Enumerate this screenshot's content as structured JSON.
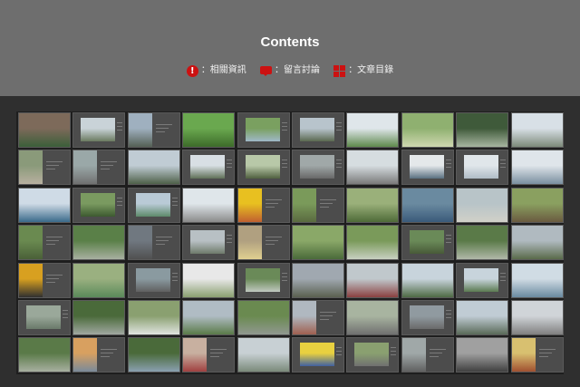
{
  "header": {
    "title": "Contents",
    "bg": "#6e6e6e"
  },
  "legend": {
    "accent": "#cc1111",
    "items": [
      {
        "icon": "info-icon",
        "label": "：相關資訊"
      },
      {
        "icon": "comment-icon",
        "label": "：留言討論"
      },
      {
        "icon": "grid-icon",
        "label": "：文章目錄"
      }
    ]
  },
  "gallery": {
    "rows": 7,
    "cols": 10,
    "thumbnails": [
      {
        "kind": "full",
        "colors": [
          "#7d6a5a",
          "#3b5f3a"
        ]
      },
      {
        "kind": "partial",
        "colors": [
          "#c9d3d8",
          "#6a7a60"
        ]
      },
      {
        "kind": "portrait",
        "colors": [
          "#9fb0bf",
          "#556055"
        ]
      },
      {
        "kind": "full",
        "colors": [
          "#6aa84f",
          "#3d6b2a"
        ]
      },
      {
        "kind": "partial",
        "colors": [
          "#7aa060",
          "#9fb8c8"
        ]
      },
      {
        "kind": "partial",
        "colors": [
          "#b8c4cc",
          "#5a6850"
        ]
      },
      {
        "kind": "full",
        "colors": [
          "#dfe6ea",
          "#5e8a4c"
        ]
      },
      {
        "kind": "full",
        "colors": [
          "#8fb070",
          "#cfd8b0"
        ]
      },
      {
        "kind": "full",
        "colors": [
          "#3f5a3a",
          "#a7b5a0"
        ]
      },
      {
        "kind": "full",
        "colors": [
          "#d8e0e6",
          "#7d8a7a"
        ]
      },
      {
        "kind": "portrait",
        "colors": [
          "#8a9a7a",
          "#b8b0a0"
        ]
      },
      {
        "kind": "portrait",
        "colors": [
          "#9aa8a8",
          "#707070"
        ]
      },
      {
        "kind": "full",
        "colors": [
          "#c0ccd4",
          "#4e6048"
        ]
      },
      {
        "kind": "partial",
        "colors": [
          "#d8dfe4",
          "#607058"
        ]
      },
      {
        "kind": "partial",
        "colors": [
          "#b8c8a8",
          "#506040"
        ]
      },
      {
        "kind": "partial",
        "colors": [
          "#a0a8a8",
          "#686868"
        ]
      },
      {
        "kind": "full",
        "colors": [
          "#d6dde0",
          "#7a7a7a"
        ]
      },
      {
        "kind": "partial",
        "colors": [
          "#e4e8ea",
          "#5a7080"
        ]
      },
      {
        "kind": "partial",
        "colors": [
          "#e0e6ea",
          "#b0bcc6"
        ]
      },
      {
        "kind": "full",
        "colors": [
          "#dfe5ea",
          "#7a8f9f"
        ]
      },
      {
        "kind": "full",
        "colors": [
          "#cfdbe6",
          "#3a6a8a"
        ]
      },
      {
        "kind": "partial",
        "colors": [
          "#7a9a60",
          "#3d5a30"
        ]
      },
      {
        "kind": "partial",
        "colors": [
          "#b9cad6",
          "#5d8a6a"
        ]
      },
      {
        "kind": "full",
        "colors": [
          "#dfe6ea",
          "#8a8a8a"
        ]
      },
      {
        "kind": "portrait",
        "colors": [
          "#e8c020",
          "#c06030"
        ]
      },
      {
        "kind": "portrait",
        "colors": [
          "#7a9a5a",
          "#5a6a40"
        ]
      },
      {
        "kind": "full",
        "colors": [
          "#9ab07a",
          "#4e6a38"
        ]
      },
      {
        "kind": "full",
        "colors": [
          "#6a8aa0",
          "#3a5a7a"
        ]
      },
      {
        "kind": "full",
        "colors": [
          "#b8c4c8",
          "#d0d0c8"
        ]
      },
      {
        "kind": "full",
        "colors": [
          "#8aa060",
          "#6a5a40"
        ]
      },
      {
        "kind": "portrait",
        "colors": [
          "#6a8a50",
          "#4a6038"
        ]
      },
      {
        "kind": "full",
        "colors": [
          "#5a8048",
          "#a8b0a0"
        ]
      },
      {
        "kind": "portrait",
        "colors": [
          "#707880",
          "#505050"
        ]
      },
      {
        "kind": "partial",
        "colors": [
          "#b8c0c4",
          "#6e7a6a"
        ]
      },
      {
        "kind": "portrait",
        "colors": [
          "#b0a080",
          "#e0d090"
        ]
      },
      {
        "kind": "full",
        "colors": [
          "#8aa868",
          "#4a6a3a"
        ]
      },
      {
        "kind": "full",
        "colors": [
          "#7a9a5a",
          "#c8d0c0"
        ]
      },
      {
        "kind": "partial",
        "colors": [
          "#6a8a58",
          "#485a38"
        ]
      },
      {
        "kind": "full",
        "colors": [
          "#5a7a48",
          "#b0b8a8"
        ]
      },
      {
        "kind": "full",
        "colors": [
          "#b0bac0",
          "#5a6a4a"
        ]
      },
      {
        "kind": "portrait",
        "colors": [
          "#d8a020",
          "#303030"
        ]
      },
      {
        "kind": "full",
        "colors": [
          "#9ab080",
          "#5a8a5a"
        ]
      },
      {
        "kind": "partial",
        "colors": [
          "#8a9aa0",
          "#606060"
        ]
      },
      {
        "kind": "full",
        "colors": [
          "#e8e8e8",
          "#8aa070"
        ]
      },
      {
        "kind": "partial",
        "colors": [
          "#6a8a58",
          "#c0c8c0"
        ]
      },
      {
        "kind": "full",
        "colors": [
          "#a0a8b0",
          "#5a6050"
        ]
      },
      {
        "kind": "full",
        "colors": [
          "#c0c8cc",
          "#8a4040"
        ]
      },
      {
        "kind": "full",
        "colors": [
          "#c8d4dc",
          "#4e6a44"
        ]
      },
      {
        "kind": "partial",
        "colors": [
          "#c8d4dc",
          "#5a7a50"
        ]
      },
      {
        "kind": "full",
        "colors": [
          "#d0dce4",
          "#6a8aa0"
        ]
      },
      {
        "kind": "partial",
        "colors": [
          "#9aa89a",
          "#6a7a6a"
        ]
      },
      {
        "kind": "full",
        "colors": [
          "#4a6a3a",
          "#a0a8a0"
        ]
      },
      {
        "kind": "full",
        "colors": [
          "#8aa070",
          "#e0e4e0"
        ]
      },
      {
        "kind": "full",
        "colors": [
          "#b0bcc4",
          "#5a7a48"
        ]
      },
      {
        "kind": "full",
        "colors": [
          "#6a8a50",
          "#909890"
        ]
      },
      {
        "kind": "portrait",
        "colors": [
          "#b0b8c0",
          "#a06050"
        ]
      },
      {
        "kind": "full",
        "colors": [
          "#a8b4a0",
          "#707070"
        ]
      },
      {
        "kind": "partial",
        "colors": [
          "#909aa0",
          "#6a6a6a"
        ]
      },
      {
        "kind": "full",
        "colors": [
          "#c0ccd4",
          "#5a6a58"
        ]
      },
      {
        "kind": "full",
        "colors": [
          "#d0d4d8",
          "#808080"
        ]
      },
      {
        "kind": "full",
        "colors": [
          "#5a7a48",
          "#a8b0a0"
        ]
      },
      {
        "kind": "portrait",
        "colors": [
          "#d8a060",
          "#7a8a9a"
        ]
      },
      {
        "kind": "full",
        "colors": [
          "#4a6a3a",
          "#8aa0b0"
        ]
      },
      {
        "kind": "portrait",
        "colors": [
          "#c8b0a0",
          "#a04040"
        ]
      },
      {
        "kind": "full",
        "colors": [
          "#c8d0d4",
          "#7a8a7a"
        ]
      },
      {
        "kind": "partial",
        "colors": [
          "#e8d040",
          "#4060a0"
        ]
      },
      {
        "kind": "partial",
        "colors": [
          "#8aa070",
          "#707070"
        ]
      },
      {
        "kind": "portrait",
        "colors": [
          "#a0a8a8",
          "#606060"
        ]
      },
      {
        "kind": "full",
        "colors": [
          "#a0a0a0",
          "#404040"
        ]
      },
      {
        "kind": "portrait",
        "colors": [
          "#d8c070",
          "#a05030"
        ]
      }
    ]
  }
}
